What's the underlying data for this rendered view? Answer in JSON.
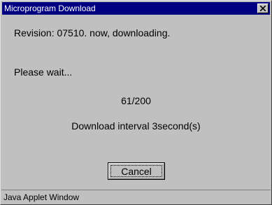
{
  "window": {
    "title": "Microprogram Download",
    "close_icon": "close-icon"
  },
  "content": {
    "revision_text": "Revision: 07510. now, downloading.",
    "wait_text": "Please wait...",
    "progress_text": "61/200",
    "interval_text": "Download interval 3second(s)"
  },
  "buttons": {
    "cancel_label": "Cancel"
  },
  "status": {
    "text": "Java Applet Window"
  },
  "colors": {
    "titlebar": "#000080",
    "window_bg": "#c0c0c0",
    "title_text": "#ffffff"
  }
}
